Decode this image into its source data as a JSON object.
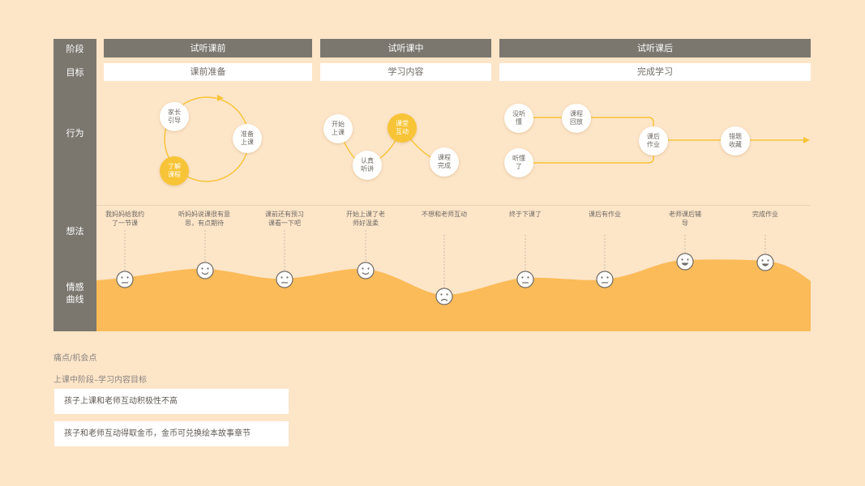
{
  "rows": {
    "stage": "阶段",
    "goal": "目标",
    "behavior": "行为",
    "thought": "想法",
    "emotion_line1": "情感",
    "emotion_line2": "曲线"
  },
  "stages": [
    {
      "title": "试听课前",
      "goal": "课前准备"
    },
    {
      "title": "试听课中",
      "goal": "学习内容"
    },
    {
      "title": "试听课后",
      "goal": "完成学习"
    }
  ],
  "behaviors": {
    "before": [
      "家长引导",
      "准备上课",
      "了解课程"
    ],
    "during": [
      "开始上课",
      "认真听讲",
      "课堂互动",
      "课程完成"
    ],
    "after": [
      "没听懂",
      "课程回放",
      "听懂了",
      "课后作业",
      "错题收藏"
    ]
  },
  "thoughts": [
    "我妈妈给我约了一节课",
    "听妈妈说课很有意思，有点期待",
    "课前还有预习课看一下吧",
    "开始上课了老师好温柔",
    "不想和老师互动",
    "终于下课了",
    "课后有作业",
    "老师课后辅导",
    "完成作业"
  ],
  "emotions": [
    "neutral",
    "happy",
    "neutral",
    "happy",
    "sad",
    "neutral",
    "neutral",
    "very-happy",
    "very-happy"
  ],
  "colors": {
    "background": "#fde5c8",
    "sidebar": "#7b776f",
    "curve": "#fbbb58",
    "highlight": "#f8c437"
  },
  "pain": {
    "title": "痛点/机会点",
    "subtitle": "上课中阶段–学习内容目标",
    "items": [
      "孩子上课和老师互动积极性不高",
      "孩子和老师互动得取金币，金币可兑换绘本故事章节"
    ]
  }
}
